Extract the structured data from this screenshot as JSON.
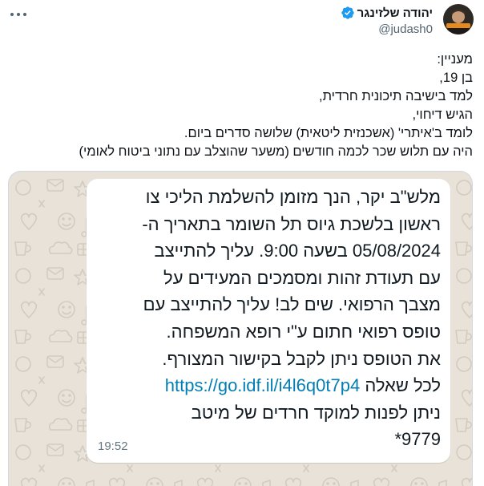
{
  "tweet": {
    "author": {
      "name": "יהודה שלזינגר",
      "handle": "@judash0",
      "verified_icon": "verified-badge-icon",
      "avatar_icon": "avatar"
    },
    "more_icon": "more-options-icon",
    "text_lines": [
      "מעניין:",
      "בן 19,",
      "למד בישיבה תיכונית חרדית,",
      "הגיש דיחוי,",
      "לומד ב'איתרי' (אשכנזית ליטאית) שלושה סדרים ביום.",
      "היה עם תלוש שכר לכמה חודשים (משער שהוצלב עם נתוני ביטוח לאומי)"
    ],
    "media": {
      "wallpaper": "whatsapp-doodle-wallpaper",
      "message": {
        "lines": [
          "מלש\"ב יקר, הנך מזומן להשלמת הליכי צו",
          "ראשון בלשכת גיוס תל השומר בתאריך ה-",
          "05/08/2024 בשעה 9:00. עליך להתייצב",
          "עם תעודת זהות ומסמכים המעידים על",
          "מצבך הרפואי. שים לב! עליך להתייצב עם",
          "טופס רפואי חתום ע\"י רופא המשפחה.",
          "את הטופס ניתן לקבל בקישור המצורף."
        ],
        "link": "https://go.idf.il/i4l6q0t7p4",
        "link_tail": "לכל שאלה",
        "closing_lines": [
          "ניתן לפנות למוקד חרדים של מיטב",
          "*9779"
        ],
        "time": "19:52"
      }
    }
  },
  "colors": {
    "text": "#0f1419",
    "secondary_text": "#536471",
    "verified_blue": "#1d9bf0",
    "chat_background": "#e8e2d9",
    "bubble": "#ffffff",
    "message_text": "#111b21",
    "link": "#027eb5",
    "timestamp": "#667781"
  }
}
